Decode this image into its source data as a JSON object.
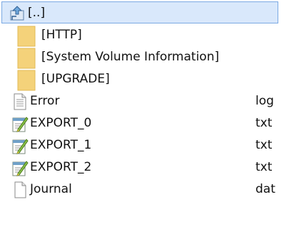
{
  "file_list": {
    "items": [
      {
        "name": "[..]",
        "ext": "",
        "icon": "parent-directory-icon",
        "selected": true
      },
      {
        "name": "[HTTP]",
        "ext": "",
        "icon": "folder-icon"
      },
      {
        "name": "[System Volume Information]",
        "ext": "",
        "icon": "folder-icon"
      },
      {
        "name": "[UPGRADE]",
        "ext": "",
        "icon": "folder-icon"
      },
      {
        "name": "Error",
        "ext": "log",
        "icon": "text-file-icon"
      },
      {
        "name": "EXPORT_0",
        "ext": "txt",
        "icon": "notepad-file-icon"
      },
      {
        "name": "EXPORT_1",
        "ext": "txt",
        "icon": "notepad-file-icon"
      },
      {
        "name": "EXPORT_2",
        "ext": "txt",
        "icon": "notepad-file-icon"
      },
      {
        "name": "Journal",
        "ext": "dat",
        "icon": "generic-file-icon"
      }
    ]
  },
  "colors": {
    "selection_background": "#d9e8fb",
    "selection_border": "#7ba9e3",
    "folder": "#f4d27a"
  }
}
